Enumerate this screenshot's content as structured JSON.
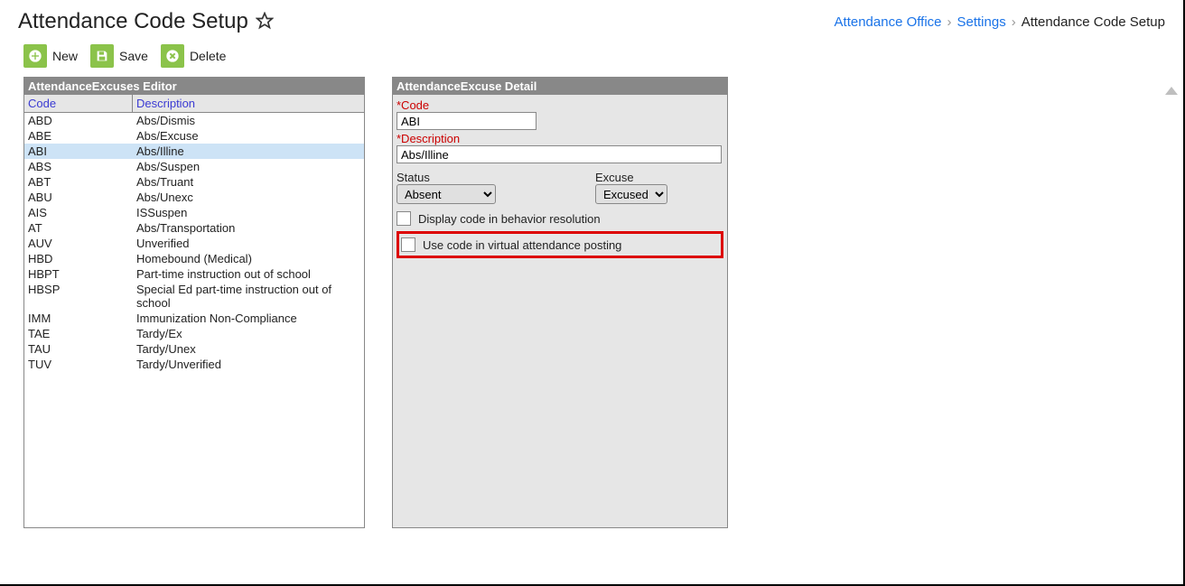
{
  "page": {
    "title": "Attendance Code Setup"
  },
  "breadcrumb": {
    "item1": "Attendance Office",
    "item2": "Settings",
    "item3": "Attendance Code Setup"
  },
  "toolbar": {
    "new": "New",
    "save": "Save",
    "delete": "Delete"
  },
  "editor": {
    "title": "AttendanceExcuses Editor",
    "col_code": "Code",
    "col_desc": "Description",
    "rows": [
      {
        "code": "ABD",
        "desc": "Abs/Dismis"
      },
      {
        "code": "ABE",
        "desc": "Abs/Excuse"
      },
      {
        "code": "ABI",
        "desc": "Abs/Illine"
      },
      {
        "code": "ABS",
        "desc": "Abs/Suspen"
      },
      {
        "code": "ABT",
        "desc": "Abs/Truant"
      },
      {
        "code": "ABU",
        "desc": "Abs/Unexc"
      },
      {
        "code": "AIS",
        "desc": "ISSuspen"
      },
      {
        "code": "AT",
        "desc": "Abs/Transportation"
      },
      {
        "code": "AUV",
        "desc": "Unverified"
      },
      {
        "code": "HBD",
        "desc": "Homebound (Medical)"
      },
      {
        "code": "HBPT",
        "desc": "Part-time instruction out of school"
      },
      {
        "code": "HBSP",
        "desc": "Special Ed part-time instruction out of school"
      },
      {
        "code": "IMM",
        "desc": "Immunization Non-Compliance"
      },
      {
        "code": "TAE",
        "desc": "Tardy/Ex"
      },
      {
        "code": "TAU",
        "desc": "Tardy/Unex"
      },
      {
        "code": "TUV",
        "desc": "Tardy/Unverified"
      }
    ],
    "selected_index": 2
  },
  "detail": {
    "title": "AttendanceExcuse Detail",
    "code_label": "*Code",
    "code_value": "ABI",
    "desc_label": "*Description",
    "desc_value": "Abs/Illine",
    "status_label": "Status",
    "status_value": "Absent",
    "excuse_label": "Excuse",
    "excuse_value": "Excused",
    "check1_label": "Display code in behavior resolution",
    "check2_label": "Use code in virtual attendance posting"
  }
}
